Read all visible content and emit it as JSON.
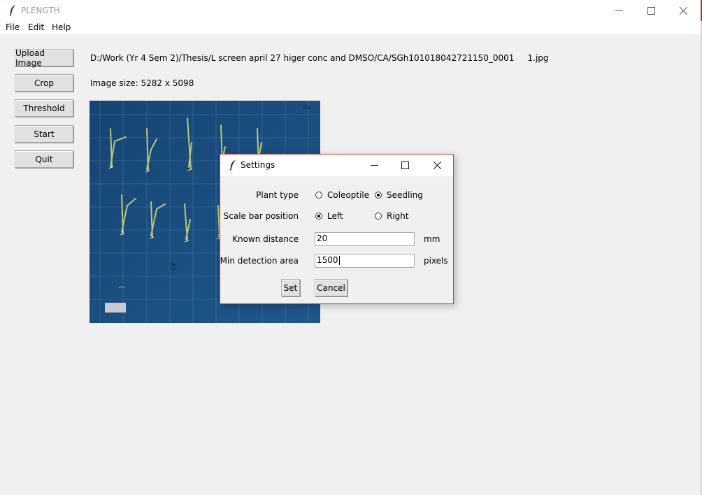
{
  "window": {
    "title": "PLENGTH",
    "icon": "feather-icon",
    "controls": [
      "minimize-icon",
      "maximize-icon",
      "close-icon"
    ]
  },
  "menubar": {
    "items": [
      "File",
      "Edit",
      "Help"
    ]
  },
  "sidebar": {
    "buttons": [
      {
        "label": "Upload Image"
      },
      {
        "label": "Crop"
      },
      {
        "label": "Threshold"
      },
      {
        "label": "Start"
      },
      {
        "label": "Quit"
      }
    ]
  },
  "main": {
    "file_path": "D:/Work (Yr 4 Sem 2)/Thesis/L screen april 27 higer conc and DMSO/CA/SGh101018042721150_0001     1.jpg",
    "image_size_text": "Image size: 5282 x 5098"
  },
  "settings_dialog": {
    "title": "Settings",
    "plant_type": {
      "label": "Plant type",
      "options": [
        {
          "label": "Coleoptile",
          "checked": false
        },
        {
          "label": "Seedling",
          "checked": true
        }
      ]
    },
    "scale_bar_position": {
      "label": "Scale bar position",
      "options": [
        {
          "label": "Left",
          "checked": true
        },
        {
          "label": "Right",
          "checked": false
        }
      ]
    },
    "known_distance": {
      "label": "Known distance",
      "value": "20",
      "unit": "mm"
    },
    "min_detection_area": {
      "label": "Min detection area",
      "value": "1500",
      "unit": "pixels"
    },
    "set_label": "Set",
    "cancel_label": "Cancel"
  },
  "colors": {
    "accent_border": "#c2472f",
    "image_background": "#174a7a"
  }
}
